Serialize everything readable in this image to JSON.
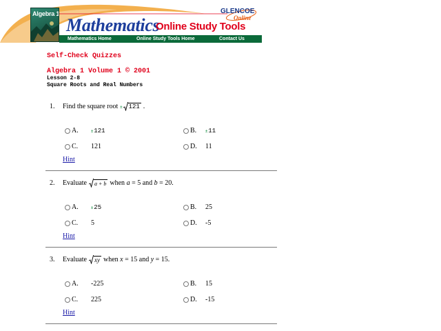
{
  "header": {
    "book_cover_title": "Algebra 1",
    "math_title": "Mathematics",
    "ost_title": "Online Study Tools",
    "logo_glencoe": "GLENCOE",
    "logo_online": "Online",
    "nav": [
      {
        "label": "Mathematics Home"
      },
      {
        "label": "Online Study Tools Home"
      },
      {
        "label": "Contact Us"
      }
    ],
    "colors": {
      "nav_bg": "#0b6a3a",
      "title_blue": "#1d3e9c",
      "title_red": "#e0001b",
      "swoosh": "#f0a040"
    }
  },
  "content": {
    "section_title": "Self-Check Quizzes",
    "book_line": "Algebra 1 Volume 1 © 2001",
    "lesson_line": "Lesson 2-8",
    "topic_line": "Square Roots and Real Numbers"
  },
  "questions": [
    {
      "num": "1.",
      "prompt": "Find the square root",
      "plusminus": "±",
      "radicand": "121",
      "suffix": ".",
      "options": [
        {
          "letter": "A.",
          "prefix": "±",
          "value": "121"
        },
        {
          "letter": "B.",
          "prefix": "±",
          "value": "11"
        },
        {
          "letter": "C.",
          "prefix": "",
          "value": "121"
        },
        {
          "letter": "D.",
          "prefix": "",
          "value": "11"
        }
      ],
      "hint": "Hint"
    },
    {
      "num": "2.",
      "prompt": "Evaluate",
      "radicand": "a + b",
      "rest_pre": "when",
      "var1": "a",
      "eq1": "= 5 and",
      "var2": "b",
      "eq2": "= 20.",
      "options": [
        {
          "letter": "A.",
          "prefix": "±",
          "value": "25"
        },
        {
          "letter": "B.",
          "prefix": "",
          "value": "25"
        },
        {
          "letter": "C.",
          "prefix": "",
          "value": "5"
        },
        {
          "letter": "D.",
          "prefix": "",
          "value": "-5"
        }
      ],
      "hint": "Hint"
    },
    {
      "num": "3.",
      "prompt": "Evaluate",
      "radicand": "xy",
      "rest_pre": "when",
      "var1": "x",
      "eq1": "= 15 and",
      "var2": "y",
      "eq2": "= 15.",
      "options": [
        {
          "letter": "A.",
          "prefix": "",
          "value": "-225"
        },
        {
          "letter": "B.",
          "prefix": "",
          "value": "15"
        },
        {
          "letter": "C.",
          "prefix": "",
          "value": "225"
        },
        {
          "letter": "D.",
          "prefix": "",
          "value": "-15"
        }
      ],
      "hint": "Hint"
    }
  ]
}
